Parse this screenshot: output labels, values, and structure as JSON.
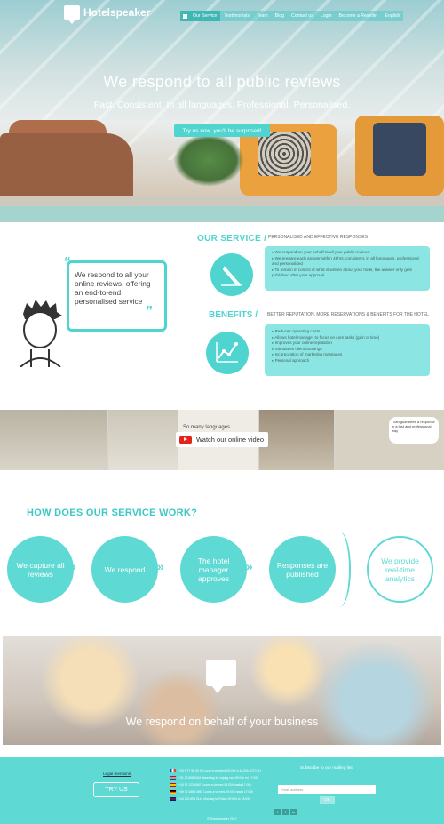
{
  "brand": {
    "name": "Hotelspeaker"
  },
  "nav": {
    "items": [
      "Our Service",
      "Testimonials",
      "Team",
      "Blog",
      "Contact us",
      "Login",
      "Become a Reseller",
      "English"
    ]
  },
  "hero": {
    "title": "We respond to all public reviews",
    "subtitle": "Fast. Consistent. In all languages. Professional. Personalised.",
    "cta": "Try us now, you'll be surprised!"
  },
  "service": {
    "title": "OUR SERVICE /",
    "tagline": "PERSONALISED AND EFFECTIVE RESPONSES",
    "items": [
      "We respond on your behalf to all your public reviews.",
      "We prepare each answer within 48hrs, consistent, in all languages, professional and personalised",
      "To remain in control of what is written about your hotel, the answer only gets published after your approval"
    ]
  },
  "benefits": {
    "title": "BENEFITS /",
    "tagline": "BETTER REPUTATION, MORE RESERVATIONS & BENEFITS FOR THE HOTEL",
    "items": [
      "Reduces operating costs",
      "Allows hotel manager to focus on core tasks (gain of time)",
      "Improves your online reputation",
      "Stimulates client bookings",
      "Incorporation of marketing messages",
      "Personal approach"
    ]
  },
  "speech": {
    "text": "We respond to all your online reviews, offering an end-to-end personalised service"
  },
  "video": {
    "label": "Watch our online video",
    "panel_text": [
      "So many languages",
      "I can guarantee a response in a fast and professional way"
    ]
  },
  "how": {
    "title": "HOW DOES OUR SERVICE WORK?",
    "steps": [
      "We capture all reviews",
      "We respond",
      "The hotel manager approves",
      "Responses are published",
      "We provide real-time analytics"
    ]
  },
  "band": {
    "text": "We respond on behalf of your business"
  },
  "footer": {
    "legal": "Legal mentions",
    "try_us": "TRY US",
    "phones": [
      "+33 1 77 98 60 39  Lundi à vendredi 09:00h à 18:00h (UTC+1)",
      "+31 20 808 0344  Maandag tot vrijdag van 09:00h tot 17:00h",
      "+34 91 123 4567  Lunes a viernes 09:00h hasta 17:00h",
      "+49 30 1663 4567  Lunes a viernes 09:00h hasta 17:00h",
      "+44 203 695 0144  Monday to Friday 09:00h to 18:00h"
    ],
    "mailing_label": "Subscribe to our mailing list",
    "email_placeholder": "Email address",
    "ok_label": "OK",
    "social": [
      "t",
      "f",
      "in"
    ],
    "copyright": "© Hotelspeaker 2017"
  },
  "colors": {
    "accent": "#4fd4cf",
    "footer": "#5fd9d4",
    "youtube": "#e62117"
  }
}
